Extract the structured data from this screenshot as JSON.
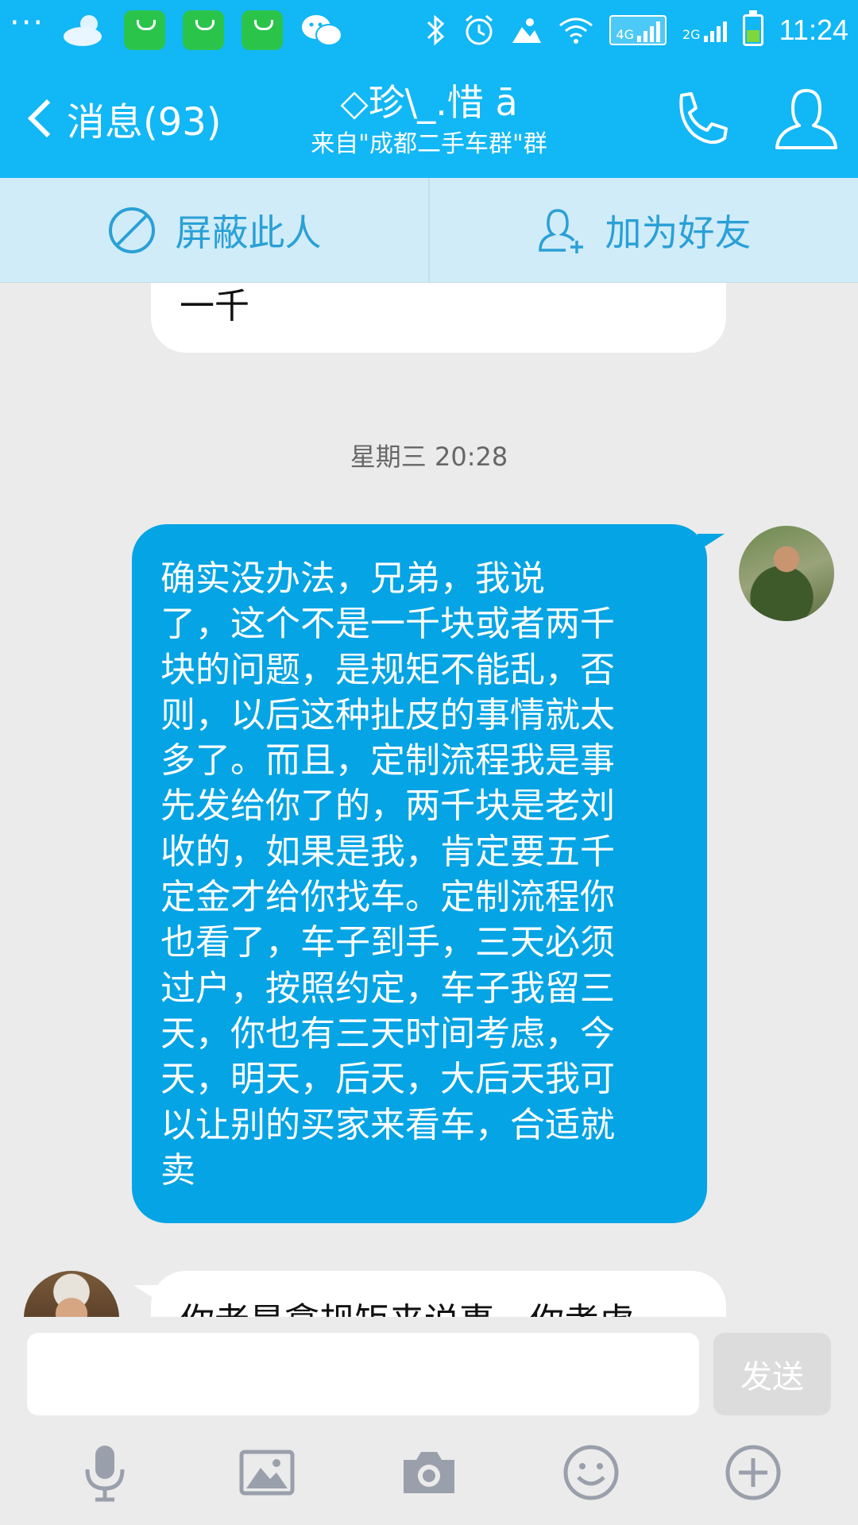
{
  "status_bar": {
    "time": "11:24",
    "network_4g": "4G",
    "network_2g": "2G",
    "apps": [
      "weather-icon",
      "app-store-icon",
      "app-store-icon",
      "app-store-icon",
      "wechat-icon"
    ]
  },
  "header": {
    "back_label": "消息(93)",
    "contact_name": "◇珍\\_.惜 ā",
    "source": "来自\"成都二手车群\"群"
  },
  "actions": {
    "block_label": "屏蔽此人",
    "add_friend_label": "加为好友"
  },
  "messages": [
    {
      "side": "left",
      "text": "一千"
    },
    {
      "side": "time",
      "text": "星期三 20:28"
    },
    {
      "side": "right",
      "lines": [
        "确实没办法，兄弟，我说",
        "了，这个不是一千块或者两千",
        "块的问题，是规矩不能乱，否",
        "则，以后这种扯皮的事情就太",
        "多了。而且，定制流程我是事",
        "先发给你了的，两千块是老刘",
        "收的，如果是我，肯定要五千",
        "定金才给你找车。定制流程你",
        "也看了，车子到手，三天必须",
        "过户，按照约定，车子我留三",
        "天，你也有三天时间考虑，今",
        "天，明天，后天，大后天我可",
        "以让别的买家来看车，合适就",
        "卖"
      ]
    },
    {
      "side": "left",
      "text": "你老是拿规矩来说事，你考虑"
    }
  ],
  "composer": {
    "input_value": "",
    "send_label": "发送"
  },
  "toolbar": [
    "microphone-icon",
    "image-icon",
    "camera-icon",
    "emoji-icon",
    "plus-icon"
  ],
  "colors": {
    "accent": "#12b7f5",
    "bubble_out": "#05a4e4",
    "action_bar": "#d0ecf9",
    "action_text": "#2aa0d6"
  }
}
